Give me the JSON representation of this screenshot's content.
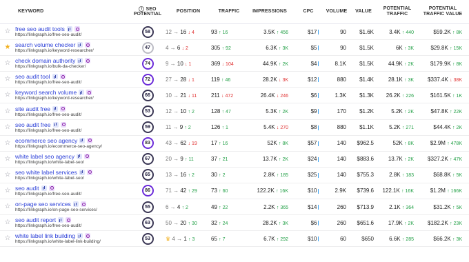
{
  "headers": {
    "keyword": "KEYWORD",
    "seo_potential_1": "SEO",
    "seo_potential_2": "POTENTIAL",
    "position": "POSITION",
    "traffic": "TRAFFIC",
    "impressions": "IMPRESSIONS",
    "cpc": "CPC",
    "volume": "VOLUME",
    "value": "VALUE",
    "potential_traffic_1": "POTENTIAL",
    "potential_traffic_2": "TRAFFIC",
    "potential_traffic_value_1": "POTENTIAL",
    "potential_traffic_value_2": "TRAFFIC VALUE"
  },
  "rows": [
    {
      "keyword": "free seo audit tools",
      "url": "https://linkgraph.io/free-seo-audit/",
      "fav": false,
      "seo": "58",
      "seo_level": "mid",
      "pos_from": "12",
      "pos_to": "16",
      "pos_dir": "down",
      "pos_delta": "4",
      "traffic": "93",
      "traf_dir": "up",
      "traf_delta": "16",
      "impr": "3.5K",
      "impr_dir": "up",
      "impr_delta": "456",
      "cpc": "$17",
      "volume": "90",
      "value": "$1.6K",
      "pt": "3.4K",
      "pt_delta": "440",
      "ptv": "$59.2K",
      "ptv_delta": "8K"
    },
    {
      "keyword": "search volume checker",
      "url": "https://linkgraph.io/keyword-researcher/",
      "fav": true,
      "seo": "47",
      "seo_level": "lo",
      "pos_from": "4",
      "pos_to": "6",
      "pos_dir": "down",
      "pos_delta": "2",
      "traffic": "305",
      "traf_dir": "up",
      "traf_delta": "92",
      "impr": "6.3K",
      "impr_dir": "up",
      "impr_delta": "3K",
      "cpc": "$5",
      "volume": "90",
      "value": "$1.5K",
      "pt": "6K",
      "pt_delta": "3K",
      "ptv": "$29.8K",
      "ptv_delta": "15K"
    },
    {
      "keyword": "check domain authority",
      "url": "https://linkgraph.io/bulk-da-checker/",
      "fav": false,
      "seo": "74",
      "seo_level": "hi",
      "pos_from": "9",
      "pos_to": "10",
      "pos_dir": "down",
      "pos_delta": "1",
      "traffic": "369",
      "traf_dir": "down",
      "traf_delta": "104",
      "impr": "44.9K",
      "impr_dir": "up",
      "impr_delta": "2K",
      "cpc": "$4",
      "volume": "8.1K",
      "value": "$1.5K",
      "pt": "44.9K",
      "pt_delta": "2K",
      "ptv": "$179.9K",
      "ptv_delta": "8K"
    },
    {
      "keyword": "seo audit tool",
      "url": "https://linkgraph.io/free-seo-audit/",
      "fav": false,
      "seo": "72",
      "seo_level": "hi",
      "pos_from": "27",
      "pos_to": "28",
      "pos_dir": "down",
      "pos_delta": "1",
      "traffic": "119",
      "traf_dir": "up",
      "traf_delta": "46",
      "impr": "28.2K",
      "impr_dir": "down",
      "impr_delta": "3K",
      "cpc": "$12",
      "volume": "880",
      "value": "$1.4K",
      "pt": "28.1K",
      "pt_delta": "3K",
      "ptv": "$337.4K",
      "ptv_delta": "38K"
    },
    {
      "keyword": "keyword search volume",
      "url": "https://linkgraph.io/keyword-researcher/",
      "fav": false,
      "seo": "66",
      "seo_level": "mid",
      "pos_from": "10",
      "pos_to": "21",
      "pos_dir": "down",
      "pos_delta": "11",
      "traffic": "211",
      "traf_dir": "down",
      "traf_delta": "472",
      "impr": "26.4K",
      "impr_dir": "down",
      "impr_delta": "246",
      "cpc": "$6",
      "volume": "1.3K",
      "value": "$1.3K",
      "pt": "26.2K",
      "pt_delta": "226",
      "ptv": "$161.5K",
      "ptv_delta": "1K"
    },
    {
      "keyword": "site audit free",
      "url": "https://linkgraph.io/free-seo-audit/",
      "fav": false,
      "seo": "53",
      "seo_level": "mid",
      "pos_from": "12",
      "pos_to": "10",
      "pos_dir": "up",
      "pos_delta": "2",
      "traffic": "128",
      "traf_dir": "up",
      "traf_delta": "47",
      "impr": "5.3K",
      "impr_dir": "up",
      "impr_delta": "2K",
      "cpc": "$9",
      "volume": "170",
      "value": "$1.2K",
      "pt": "5.2K",
      "pt_delta": "2K",
      "ptv": "$47.8K",
      "ptv_delta": "22K"
    },
    {
      "keyword": "seo audit free",
      "url": "https://linkgraph.io/free-seo-audit/",
      "fav": false,
      "seo": "59",
      "seo_level": "mid",
      "pos_from": "11",
      "pos_to": "9",
      "pos_dir": "up",
      "pos_delta": "2",
      "traffic": "126",
      "traf_dir": "up",
      "traf_delta": "1",
      "impr": "5.4K",
      "impr_dir": "down",
      "impr_delta": "270",
      "cpc": "$8",
      "volume": "880",
      "value": "$1.1K",
      "pt": "5.2K",
      "pt_delta": "271",
      "ptv": "$44.4K",
      "ptv_delta": "2K"
    },
    {
      "keyword": "ecommerce seo agency",
      "url": "https://linkgraph.io/ecommerce-seo-agency/",
      "fav": false,
      "seo": "83",
      "seo_level": "hi",
      "pos_from": "43",
      "pos_to": "62",
      "pos_dir": "down",
      "pos_delta": "19",
      "traffic": "17",
      "traf_dir": "up",
      "traf_delta": "16",
      "impr": "52K",
      "impr_dir": "up",
      "impr_delta": "8K",
      "cpc": "$57",
      "volume": "140",
      "value": "$962.5",
      "pt": "52K",
      "pt_delta": "8K",
      "ptv": "$2.9M",
      "ptv_delta": "478K"
    },
    {
      "keyword": "white label seo agency",
      "url": "https://linkgraph.io/white-label-seo/",
      "fav": false,
      "seo": "67",
      "seo_level": "mid",
      "pos_from": "20",
      "pos_to": "9",
      "pos_dir": "up",
      "pos_delta": "11",
      "traffic": "37",
      "traf_dir": "up",
      "traf_delta": "21",
      "impr": "13.7K",
      "impr_dir": "up",
      "impr_delta": "2K",
      "cpc": "$24",
      "volume": "140",
      "value": "$883.6",
      "pt": "13.7K",
      "pt_delta": "2K",
      "ptv": "$327.2K",
      "ptv_delta": "47K"
    },
    {
      "keyword": "seo white label services",
      "url": "https://linkgraph.io/white-label-seo/",
      "fav": false,
      "seo": "65",
      "seo_level": "mid",
      "pos_from": "13",
      "pos_to": "16",
      "pos_dir": "up",
      "pos_delta": "2",
      "traffic": "30",
      "traf_dir": "up",
      "traf_delta": "2",
      "impr": "2.8K",
      "impr_dir": "up",
      "impr_delta": "185",
      "cpc": "$25",
      "volume": "140",
      "value": "$755.3",
      "pt": "2.8K",
      "pt_delta": "183",
      "ptv": "$68.8K",
      "ptv_delta": "5K"
    },
    {
      "keyword": "seo audit",
      "url": "https://linkgraph.io/free-seo-audit/",
      "fav": false,
      "seo": "86",
      "seo_level": "hi",
      "pos_from": "71",
      "pos_to": "42",
      "pos_dir": "up",
      "pos_delta": "29",
      "traffic": "73",
      "traf_dir": "up",
      "traf_delta": "60",
      "impr": "122.2K",
      "impr_dir": "up",
      "impr_delta": "16K",
      "cpc": "$10",
      "volume": "2.9K",
      "value": "$739.6",
      "pt": "122.1K",
      "pt_delta": "16K",
      "ptv": "$1.2M",
      "ptv_delta": "166K"
    },
    {
      "keyword": "on-page seo services",
      "url": "https://linkgraph.io/on-page-seo-services/",
      "fav": false,
      "seo": "55",
      "seo_level": "mid",
      "pos_from": "6",
      "pos_to": "4",
      "pos_dir": "up",
      "pos_delta": "2",
      "traffic": "49",
      "traf_dir": "up",
      "traf_delta": "22",
      "impr": "2.2K",
      "impr_dir": "up",
      "impr_delta": "365",
      "cpc": "$14",
      "volume": "260",
      "value": "$713.9",
      "pt": "2.1K",
      "pt_delta": "364",
      "ptv": "$31.2K",
      "ptv_delta": "5K"
    },
    {
      "keyword": "seo audit report",
      "url": "https://linkgraph.io/free-seo-audit/",
      "fav": false,
      "seo": "63",
      "seo_level": "mid",
      "pos_from": "50",
      "pos_to": "20",
      "pos_dir": "up",
      "pos_delta": "30",
      "traffic": "32",
      "traf_dir": "up",
      "traf_delta": "24",
      "impr": "28.2K",
      "impr_dir": "up",
      "impr_delta": "3K",
      "cpc": "$6",
      "volume": "260",
      "value": "$651.6",
      "pt": "17.9K",
      "pt_delta": "2K",
      "ptv": "$182.2K",
      "ptv_delta": "23K"
    },
    {
      "keyword": "white label link building",
      "url": "https://linkgraph.io/white-label-link-building/",
      "fav": false,
      "seo": "53",
      "seo_level": "mid",
      "pos_crown": true,
      "pos_from": "4",
      "pos_to": "1",
      "pos_dir": "up",
      "pos_delta": "3",
      "traffic": "65",
      "traf_dir": "up",
      "traf_delta": "7",
      "impr": "6.7K",
      "impr_dir": "up",
      "impr_delta": "292",
      "cpc": "$10",
      "volume": "60",
      "value": "$650",
      "pt": "6.6K",
      "pt_delta": "285",
      "ptv": "$66.2K",
      "ptv_delta": "3K"
    }
  ]
}
